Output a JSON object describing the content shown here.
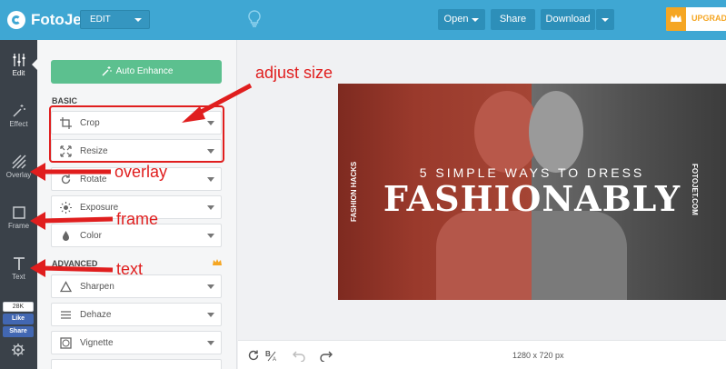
{
  "app": {
    "name": "FotoJet",
    "mode": "EDIT"
  },
  "toolbar": {
    "open_label": "Open",
    "share_label": "Share",
    "download_label": "Download",
    "upgrade_label": "UPGRADE"
  },
  "leftnav": {
    "items": [
      {
        "label": "Edit",
        "icon": "sliders-icon"
      },
      {
        "label": "Effect",
        "icon": "magic-wand-icon"
      },
      {
        "label": "Overlay",
        "icon": "hatch-icon"
      },
      {
        "label": "Frame",
        "icon": "frame-icon"
      },
      {
        "label": "Text",
        "icon": "text-icon"
      }
    ],
    "fb_count": "28K",
    "fb_like": "Like",
    "fb_share": "Share"
  },
  "panel": {
    "auto_enhance": "Auto Enhance",
    "basic_label": "BASIC",
    "basic_tools": [
      {
        "label": "Crop",
        "icon": "crop-icon"
      },
      {
        "label": "Resize",
        "icon": "resize-icon"
      },
      {
        "label": "Rotate",
        "icon": "rotate-icon"
      },
      {
        "label": "Exposure",
        "icon": "sun-icon"
      },
      {
        "label": "Color",
        "icon": "drop-icon"
      }
    ],
    "advanced_label": "ADVANCED",
    "advanced_tools": [
      {
        "label": "Sharpen",
        "icon": "triangle-icon"
      },
      {
        "label": "Dehaze",
        "icon": "lines-icon"
      },
      {
        "label": "Vignette",
        "icon": "vignette-icon"
      }
    ]
  },
  "canvas": {
    "subtitle": "5 SIMPLE WAYS TO DRESS",
    "title": "FASHIONABLY",
    "side_left": "FASHION HACKS",
    "side_right": "FOTOJET.COM",
    "dimensions": "1280 x 720 px"
  },
  "annotations": {
    "adjust_size": "adjust size",
    "overlay": "overlay",
    "frame": "frame",
    "text": "text"
  },
  "colors": {
    "topbar": "#3fa7d3",
    "leftnav": "#3a4149",
    "accent_green": "#5cc08f",
    "annotation_red": "#e01e1e",
    "premium": "#f5a623"
  }
}
